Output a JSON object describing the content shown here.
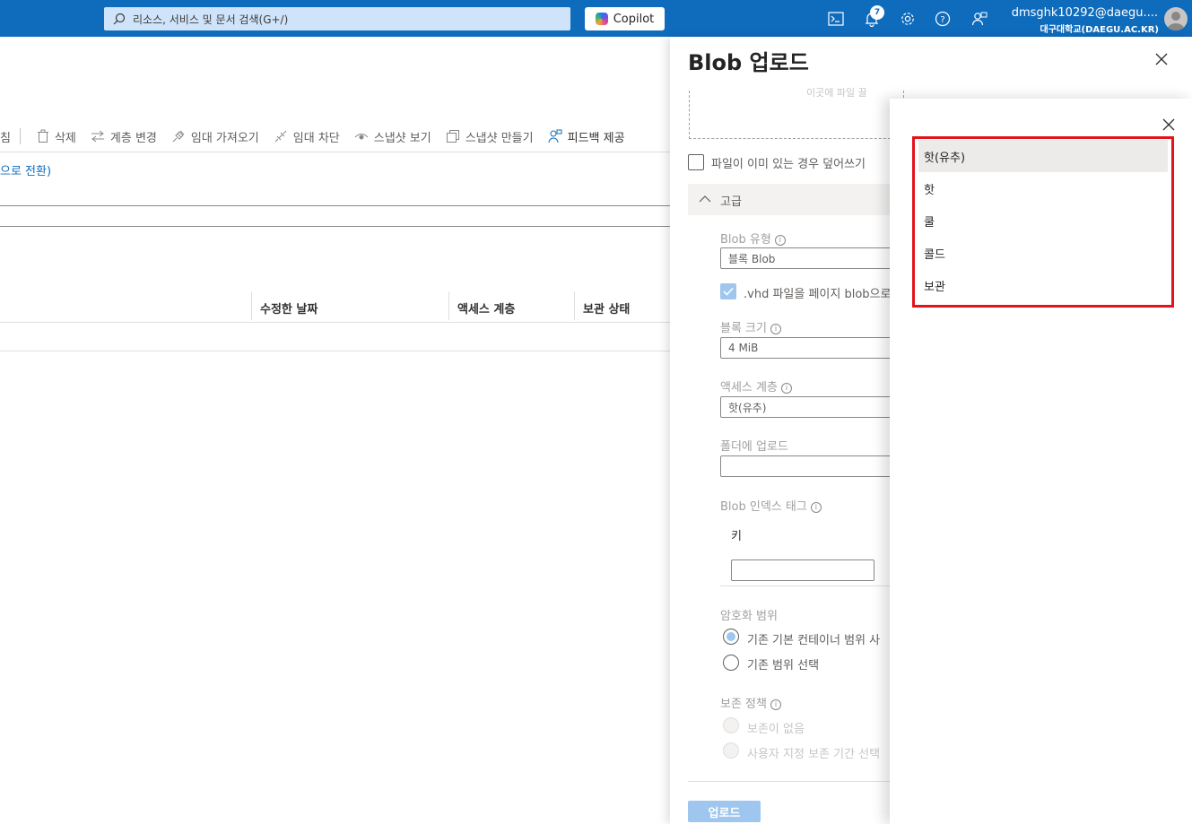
{
  "topbar": {
    "search_placeholder": "리소스, 서비스 및 문서 검색(G+/)",
    "copilot_label": "Copilot",
    "notification_count": "7",
    "user_name": "dmsghk10292@daegu....",
    "user_org": "대구대학교(DAEGU.AC.KR)"
  },
  "toolbar": {
    "partial_label": "침",
    "delete_label": "삭제",
    "change_tier_label": "계층 변경",
    "acquire_lease_label": "임대 가져오기",
    "break_lease_label": "임대 차단",
    "view_snapshots_label": "스냅샷 보기",
    "create_snapshot_label": "스냅샷 만들기",
    "feedback_label": "피드백 제공"
  },
  "main": {
    "switch_link": "으로 전환)",
    "columns": [
      "수정한 날짜",
      "액세스 계층",
      "보관 상태"
    ]
  },
  "panel": {
    "title": "Blob 업로드",
    "dropzone_text": "이곳에 파일 끌",
    "overwrite_label": "파일이 이미 있는 경우 덮어쓰기",
    "advanced_label": "고급",
    "blob_type_label": "Blob 유형",
    "blob_type_value": "블록 Blob",
    "vhd_label": ".vhd 파일을 페이지 blob으로",
    "block_size_label": "블록 크기",
    "block_size_value": "4 MiB",
    "access_tier_label": "액세스 계층",
    "access_tier_value": "핫(유추)",
    "upload_folder_label": "폴더에 업로드",
    "upload_folder_value": "",
    "index_tags_label": "Blob 인덱스 태그",
    "key_label": "키",
    "encryption_label": "암호화 범위",
    "encryption_opt1": "기존 기본 컨테이너 범위 사",
    "encryption_opt2": "기존 범위 선택",
    "retention_label": "보존 정책",
    "retention_opt1": "보존이 없음",
    "retention_opt2": "사용자 지정 보존 기간 선택",
    "upload_button": "업로드"
  },
  "dropdown": {
    "options": [
      "핫(유추)",
      "핫",
      "쿨",
      "콜드",
      "보관"
    ],
    "selected": "핫(유추)",
    "highlight_color": "#e3121b"
  }
}
